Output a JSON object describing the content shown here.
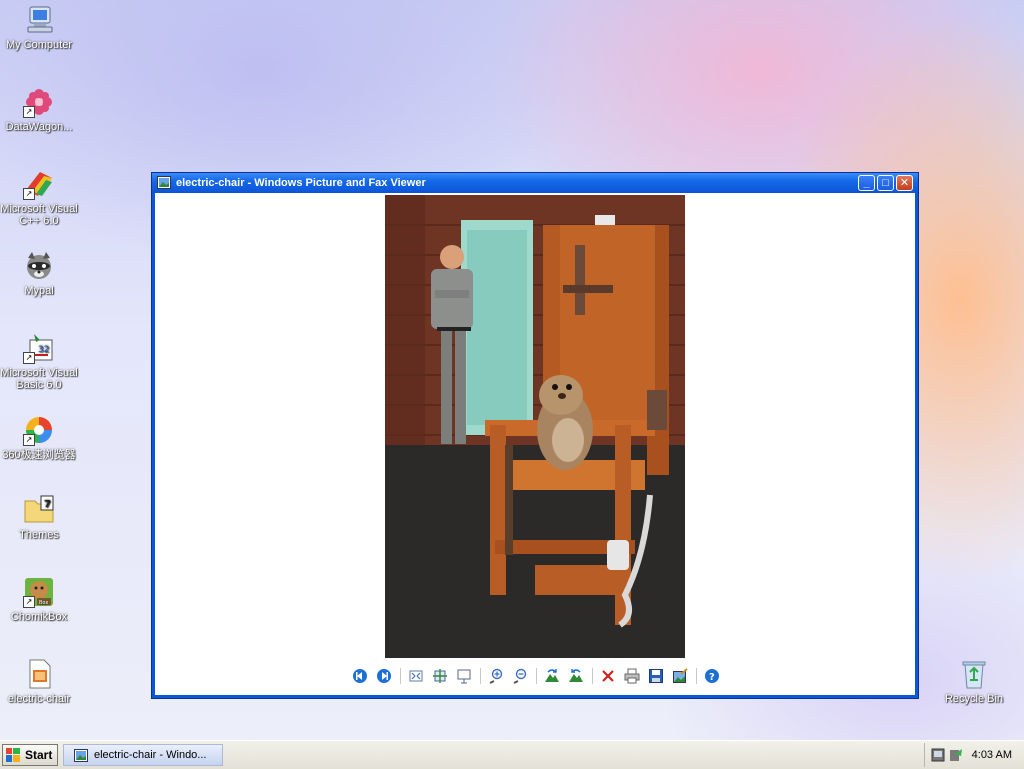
{
  "desktop": {
    "icons": [
      {
        "label": "My Computer",
        "icon": "computer-icon"
      },
      {
        "label": "DataWagon...",
        "icon": "flower-icon"
      },
      {
        "label": "Microsoft Visual C++ 6.0",
        "icon": "visual-cpp-icon"
      },
      {
        "label": "Mypal",
        "icon": "raccoon-icon"
      },
      {
        "label": "Microsoft Visual Basic 6.0",
        "icon": "visual-basic-icon"
      },
      {
        "label": "360极速浏览器",
        "icon": "browser-360-icon"
      },
      {
        "label": "Themes",
        "icon": "folder-icon"
      },
      {
        "label": "ChomikBox",
        "icon": "chomikbox-icon"
      },
      {
        "label": "electric-chair",
        "icon": "image-file-icon"
      },
      {
        "label": "Recycle Bin",
        "icon": "recycle-bin-icon"
      }
    ]
  },
  "window": {
    "title": "electric-chair - Windows Picture and Fax Viewer",
    "buttons": {
      "minimize": "_",
      "maximize": "□",
      "close": "✕"
    },
    "toolbar": [
      "previous-image-icon",
      "next-image-icon",
      "best-fit-icon",
      "actual-size-icon",
      "slideshow-icon",
      "zoom-in-icon",
      "zoom-out-icon",
      "rotate-clockwise-icon",
      "rotate-counterclockwise-icon",
      "delete-icon",
      "print-icon",
      "save-icon",
      "open-editor-icon",
      "help-icon"
    ]
  },
  "taskbar": {
    "start_label": "Start",
    "task_label": "electric-chair - Windo...",
    "clock": "4:03 AM"
  },
  "colors": {
    "title_bar": "#0b55d6",
    "taskbar": "#e3e1d6",
    "delete_red": "#d42020",
    "nav_blue": "#1d6fd4"
  }
}
